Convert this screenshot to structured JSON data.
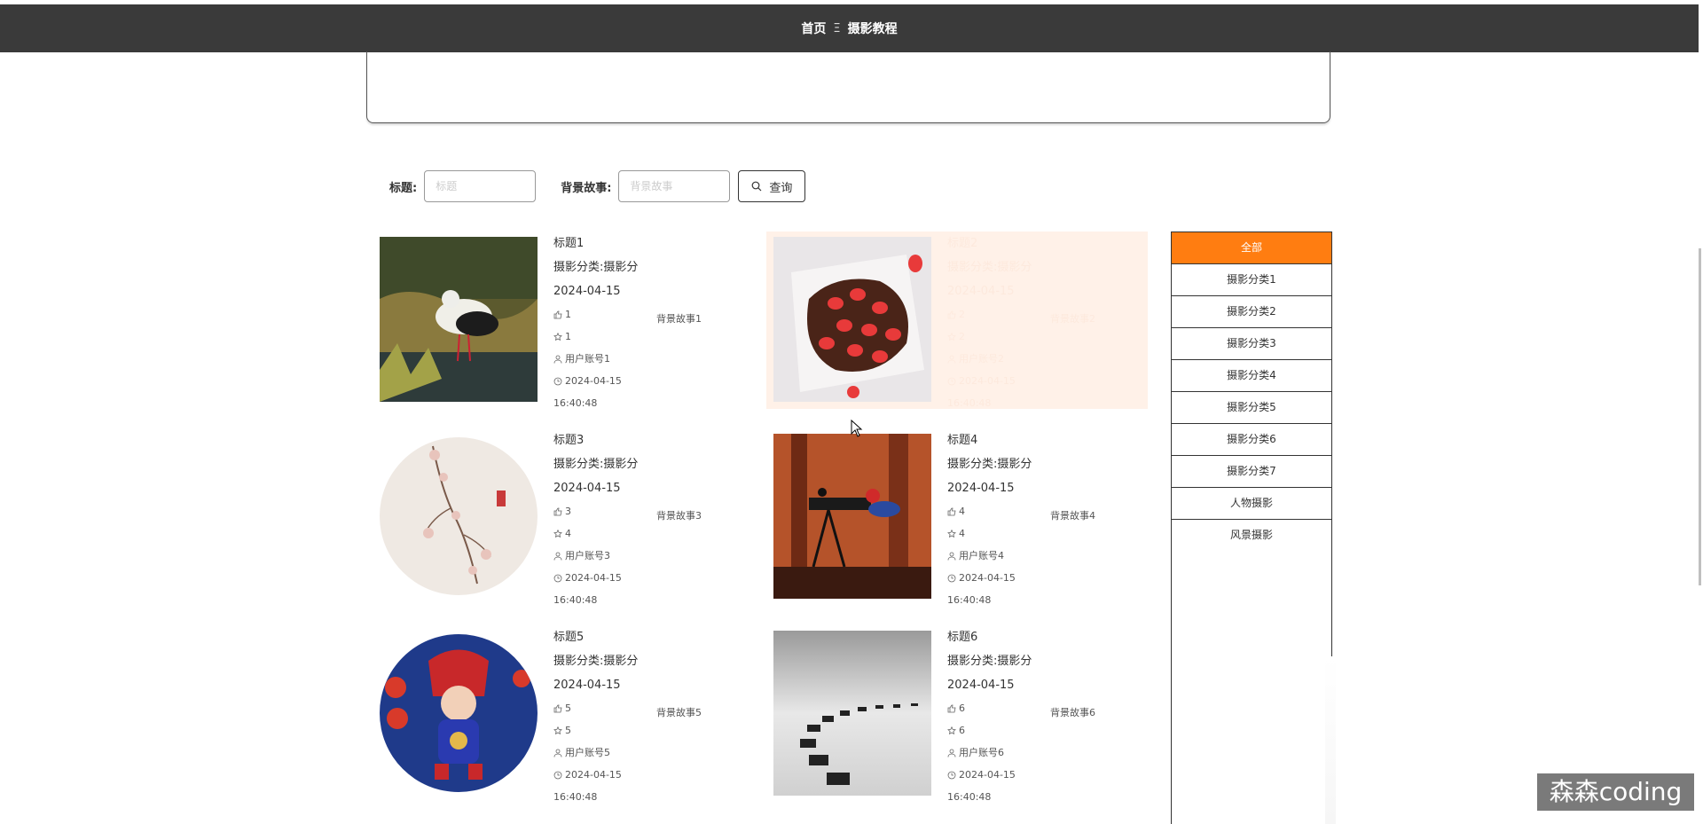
{
  "nav": {
    "home": "首页",
    "separator": "Ξ",
    "current": "摄影教程"
  },
  "search": {
    "title_label": "标题:",
    "title_placeholder": "标题",
    "story_label": "背景故事:",
    "story_placeholder": "背景故事",
    "button_label": "查询"
  },
  "cards": [
    {
      "title": "标题1",
      "category": "摄影分类:摄影分",
      "date": "2024-04-15",
      "likes": "1",
      "favorites": "1",
      "user": "用户账号1",
      "time_date": "2024-04-15",
      "time_clock": "16:40:48",
      "story": "背景故事1"
    },
    {
      "title": "标题2",
      "category": "摄影分类:摄影分",
      "date": "2024-04-15",
      "likes": "2",
      "favorites": "2",
      "user": "用户账号2",
      "time_date": "2024-04-15",
      "time_clock": "16:40:48",
      "story": "背景故事2"
    },
    {
      "title": "标题3",
      "category": "摄影分类:摄影分",
      "date": "2024-04-15",
      "likes": "3",
      "favorites": "4",
      "user": "用户账号3",
      "time_date": "2024-04-15",
      "time_clock": "16:40:48",
      "story": "背景故事3"
    },
    {
      "title": "标题4",
      "category": "摄影分类:摄影分",
      "date": "2024-04-15",
      "likes": "4",
      "favorites": "4",
      "user": "用户账号4",
      "time_date": "2024-04-15",
      "time_clock": "16:40:48",
      "story": "背景故事4"
    },
    {
      "title": "标题5",
      "category": "摄影分类:摄影分",
      "date": "2024-04-15",
      "likes": "5",
      "favorites": "5",
      "user": "用户账号5",
      "time_date": "2024-04-15",
      "time_clock": "16:40:48",
      "story": "背景故事5"
    },
    {
      "title": "标题6",
      "category": "摄影分类:摄影分",
      "date": "2024-04-15",
      "likes": "6",
      "favorites": "6",
      "user": "用户账号6",
      "time_date": "2024-04-15",
      "time_clock": "16:40:48",
      "story": "背景故事6"
    }
  ],
  "sidebar": {
    "items": [
      "全部",
      "摄影分类1",
      "摄影分类2",
      "摄影分类3",
      "摄影分类4",
      "摄影分类5",
      "摄影分类6",
      "摄影分类7",
      "人物摄影",
      "风景摄影"
    ]
  },
  "watermark": "森森coding",
  "colors": {
    "nav_bg": "#3a3a3a",
    "accent": "#ff7d11",
    "hover_bg": "#fff1e8"
  }
}
